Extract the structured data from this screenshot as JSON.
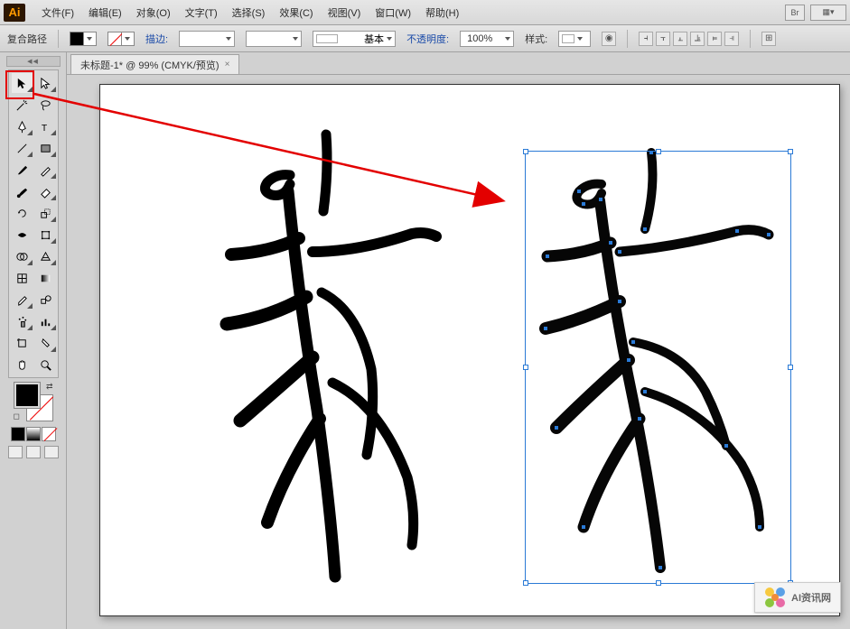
{
  "app": {
    "logo": "Ai"
  },
  "menu": {
    "file": "文件(F)",
    "edit": "编辑(E)",
    "object": "对象(O)",
    "type": "文字(T)",
    "select": "选择(S)",
    "effect": "效果(C)",
    "view": "视图(V)",
    "window": "窗口(W)",
    "help": "帮助(H)",
    "br_chip": "Br"
  },
  "control": {
    "selection_kind": "复合路径",
    "stroke_label": "描边:",
    "brush_label": "基本",
    "opacity_label": "不透明度:",
    "opacity_value": "100%",
    "style_label": "样式:"
  },
  "tab": {
    "title": "未标题-1* @ 99% (CMYK/预览)",
    "close": "×"
  },
  "tools": {
    "selection": "selection",
    "direct": "direct-selection",
    "wand": "magic-wand",
    "lasso": "lasso",
    "pen": "pen",
    "type": "type",
    "line": "line-segment",
    "rect": "rectangle",
    "brush": "paintbrush",
    "pencil": "pencil",
    "blob": "blob-brush",
    "eraser": "eraser",
    "rotate": "rotate",
    "scale": "scale",
    "width": "width-tool",
    "warp": "free-transform",
    "shape": "shape-builder",
    "perspective": "perspective-grid",
    "mesh": "mesh",
    "gradient": "gradient",
    "eyedrop": "eyedropper",
    "blend": "blend",
    "symbol": "symbol-sprayer",
    "graph": "column-graph",
    "artb": "artboard",
    "slice": "slice",
    "hand": "hand",
    "zoom": "zoom"
  },
  "watermark": {
    "text": "AI资讯网"
  },
  "selection_bbox": {
    "handles": 8
  }
}
